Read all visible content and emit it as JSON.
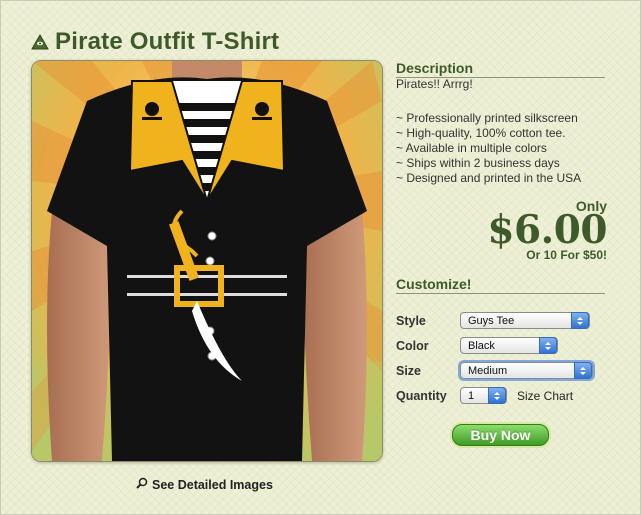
{
  "product": {
    "title": "Pirate Outfit T-Shirt",
    "title_icon": "pyramid-eye-icon",
    "see_detailed_images": "See Detailed Images"
  },
  "description": {
    "heading": "Description",
    "tagline": "Pirates!! Arrrg!",
    "features": [
      "~ Professionally printed silkscreen",
      "~ High-quality, 100% cotton tee.",
      "~ Available in multiple colors",
      "~ Ships within 2 business days",
      "~ Designed and printed in the USA"
    ]
  },
  "pricing": {
    "only": "Only",
    "price": "$6.00",
    "bulk": "Or 10 For $50!"
  },
  "customize": {
    "heading": "Customize!",
    "style_label": "Style",
    "style_value": "Guys Tee",
    "color_label": "Color",
    "color_value": "Black",
    "size_label": "Size",
    "size_value": "Medium",
    "quantity_label": "Quantity",
    "quantity_value": "1",
    "size_chart": "Size Chart"
  },
  "buy_button": "Buy Now",
  "colors": {
    "heading_green": "#3f5a2a",
    "buy_green": "#4caf2f",
    "shirt": "#111111",
    "collar_gold": "#f0b31d"
  }
}
